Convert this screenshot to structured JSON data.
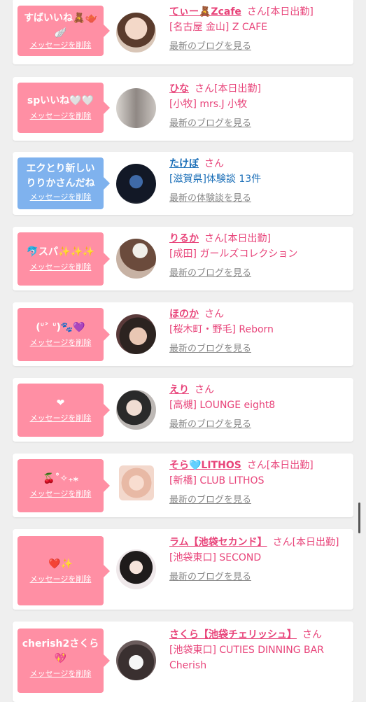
{
  "items": [
    {
      "message": "すばいいね🧸🫖\n🪽",
      "delete": "メッセージを削除",
      "name": "てぃー🧸Zcafe",
      "san": "さん[本日出勤]",
      "shop": "[名古屋 金山] Z CAFE",
      "link": "最新のブログを見る",
      "color": "pink"
    },
    {
      "message": "spいいね🤍🤍",
      "delete": "メッセージを削除",
      "name": "ひな",
      "san": "さん[本日出勤]",
      "shop": "[小牧] mrs.J 小牧",
      "link": "最新のブログを見る",
      "color": "pink"
    },
    {
      "message": "エクとり新しいりりかさんだね",
      "delete": "メッセージを削除",
      "name": "たけぼ",
      "san": "さん",
      "shop": "[滋賀県]体験談 13件",
      "link": "最新の体験談を見る",
      "color": "blue"
    },
    {
      "message": "🐬スパ✨✨✨",
      "delete": "メッセージを削除",
      "name": "りるか",
      "san": "さん[本日出勤]",
      "shop": "[成田] ガールズコレクション",
      "link": "最新のブログを見る",
      "color": "pink"
    },
    {
      "message": "(ᐡ˃ ᐡ)🐾💜",
      "delete": "メッセージを削除",
      "name": "ほのか",
      "san": "さん",
      "shop": "[桜木町・野毛] Reborn",
      "link": "最新のブログを見る",
      "color": "pink"
    },
    {
      "message": "❤",
      "delete": "メッセージを削除",
      "name": "えり",
      "san": "さん",
      "shop": "[高槻] LOUNGE eight8",
      "link": "最新のブログを見る",
      "color": "pink"
    },
    {
      "message": "🍒˚✧₊⁎",
      "delete": "メッセージを削除",
      "name": "そら🩵LITHOS",
      "san": "さん[本日出勤]",
      "shop": "[新橋] CLUB LITHOS",
      "link": "最新のブログを見る",
      "color": "pink"
    },
    {
      "message": "❤️✨",
      "delete": "メッセージを削除",
      "name": "ラム【池袋セカンド】",
      "san": "さん[本日出勤]",
      "shop": "[池袋東口] SECOND",
      "link": "最新のブログを見る",
      "color": "pink"
    },
    {
      "message": "cherish2さくら💖",
      "delete": "メッセージを削除",
      "name": "さくら【池袋チェリッシュ】",
      "san": "さん",
      "shop": "[池袋東口] CUTIES DINNING BAR Cherish",
      "link": "",
      "color": "pink"
    }
  ],
  "colors": {
    "pink": "#ff8fa4",
    "blue": "#7fb2ee",
    "name": "#e8447a",
    "reviewer": "#1b6fb8"
  }
}
